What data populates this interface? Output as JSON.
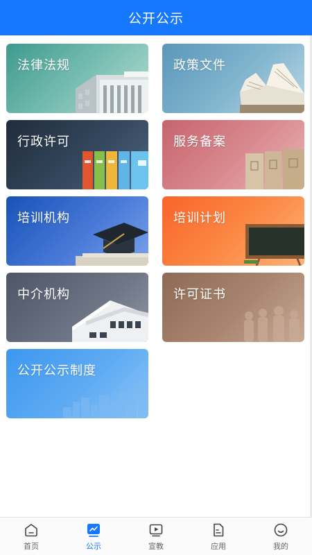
{
  "header": {
    "title": "公开公示"
  },
  "cards": [
    {
      "label": "法律法规"
    },
    {
      "label": "政策文件"
    },
    {
      "label": "行政许可"
    },
    {
      "label": "服务备案"
    },
    {
      "label": "培训机构"
    },
    {
      "label": "培训计划"
    },
    {
      "label": "中介机构"
    },
    {
      "label": "许可证书"
    },
    {
      "label": "公开公示制度"
    }
  ],
  "tabbar": {
    "active_index": 1,
    "active_color": "#1677ff",
    "items": [
      {
        "label": "首页",
        "icon": "home-icon"
      },
      {
        "label": "公示",
        "icon": "chart-icon"
      },
      {
        "label": "宣教",
        "icon": "video-play-icon"
      },
      {
        "label": "应用",
        "icon": "document-icon"
      },
      {
        "label": "我的",
        "icon": "smiley-face-icon"
      }
    ]
  },
  "colors": {
    "primary": "#1677ff",
    "tab_inactive": "#666666"
  }
}
